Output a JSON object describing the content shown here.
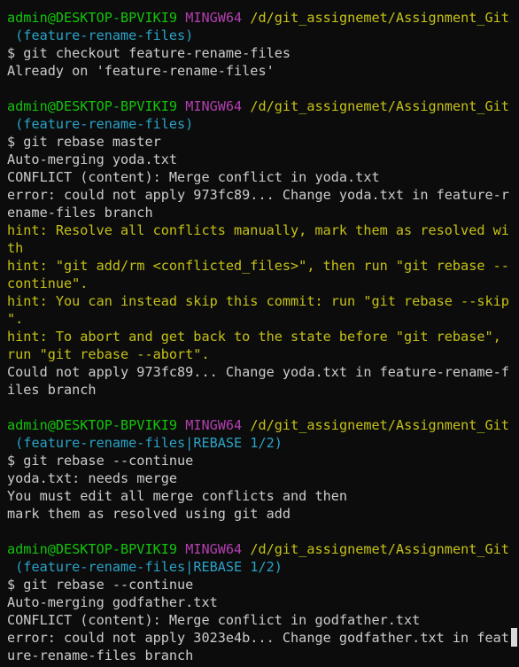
{
  "window": {
    "title": "",
    "scrollbar_visible": true
  },
  "prompt": {
    "user_host": "admin@DESKTOP-BPVIKI9",
    "shell": "MINGW64",
    "path": "/d/git_assignemet/Assignment_Git"
  },
  "colors": {
    "background": "#0c0c0c",
    "text": "#cccccc",
    "prompt_user": "#13c40b",
    "prompt_shell": "#b23fb0",
    "prompt_path": "#c5c116",
    "prompt_branch": "#2aa3c7",
    "hint": "#c5c116"
  },
  "blocks": [
    {
      "branch": "(feature-rename-files)",
      "command": "$ git checkout feature-rename-files",
      "output": [
        {
          "text": "Already on 'feature-rename-files'",
          "kind": "out"
        }
      ]
    },
    {
      "branch": "(feature-rename-files)",
      "command": "$ git rebase master",
      "output": [
        {
          "text": "Auto-merging yoda.txt",
          "kind": "out"
        },
        {
          "text": "CONFLICT (content): Merge conflict in yoda.txt",
          "kind": "out"
        },
        {
          "text": "error: could not apply 973fc89... Change yoda.txt in feature-r",
          "kind": "out"
        },
        {
          "text": "ename-files branch",
          "kind": "out"
        },
        {
          "text": "hint: Resolve all conflicts manually, mark them as resolved wi",
          "kind": "hint"
        },
        {
          "text": "th",
          "kind": "hint"
        },
        {
          "text": "hint: \"git add/rm <conflicted_files>\", then run \"git rebase --",
          "kind": "hint"
        },
        {
          "text": "continue\".",
          "kind": "hint"
        },
        {
          "text": "hint: You can instead skip this commit: run \"git rebase --skip",
          "kind": "hint"
        },
        {
          "text": "\".",
          "kind": "hint"
        },
        {
          "text": "hint: To abort and get back to the state before \"git rebase\",",
          "kind": "hint"
        },
        {
          "text": "run \"git rebase --abort\".",
          "kind": "hint"
        },
        {
          "text": "Could not apply 973fc89... Change yoda.txt in feature-rename-f",
          "kind": "out"
        },
        {
          "text": "iles branch",
          "kind": "out"
        }
      ]
    },
    {
      "branch": "(feature-rename-files|REBASE 1/2)",
      "command": "$ git rebase --continue",
      "output": [
        {
          "text": "yoda.txt: needs merge",
          "kind": "out"
        },
        {
          "text": "You must edit all merge conflicts and then",
          "kind": "out"
        },
        {
          "text": "mark them as resolved using git add",
          "kind": "out"
        }
      ]
    },
    {
      "branch": "(feature-rename-files|REBASE 1/2)",
      "command": "$ git rebase --continue",
      "output": [
        {
          "text": "Auto-merging godfather.txt",
          "kind": "out"
        },
        {
          "text": "CONFLICT (content): Merge conflict in godfather.txt",
          "kind": "out"
        },
        {
          "text": "error: could not apply 3023e4b... Change godfather.txt in feat",
          "kind": "out"
        },
        {
          "text": "ure-rename-files branch",
          "kind": "out"
        }
      ]
    }
  ]
}
